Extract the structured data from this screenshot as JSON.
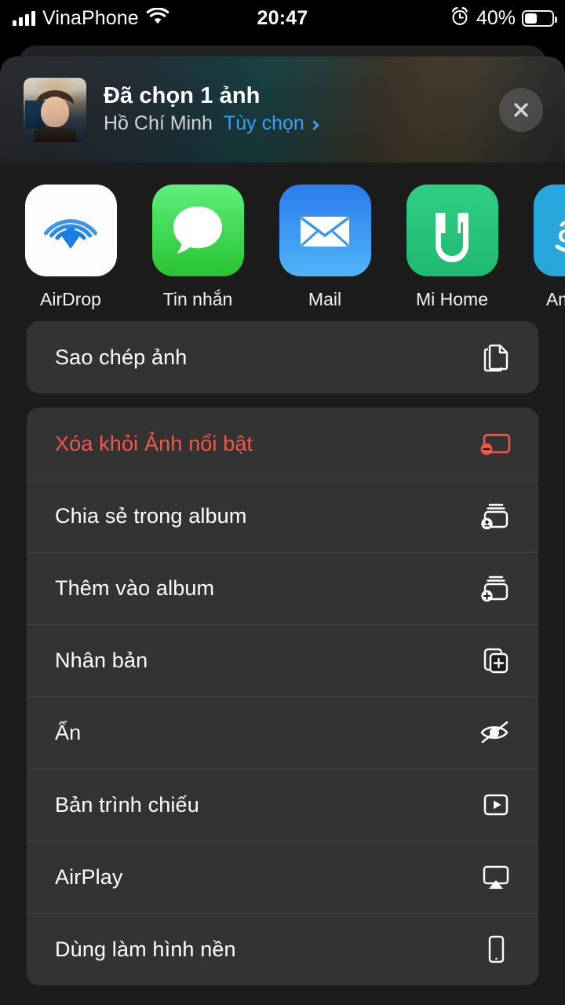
{
  "status_bar": {
    "carrier": "VinaPhone",
    "time": "20:47",
    "battery_percent": "40%",
    "battery_level": 40,
    "icons": [
      "signal-bars-icon",
      "wifi-icon",
      "alarm-clock-icon",
      "battery-icon"
    ]
  },
  "share_sheet": {
    "header": {
      "title": "Đã chọn 1 ảnh",
      "location": "Hồ Chí Minh",
      "options_label": "Tùy chọn",
      "options_color": "#3b9ef2",
      "close_label": "Đóng"
    },
    "apps": [
      {
        "label": "AirDrop",
        "icon": "airdrop-icon",
        "color": "#2f7ce0"
      },
      {
        "label": "Tin nhắn",
        "icon": "messages-icon",
        "color": "#28c231"
      },
      {
        "label": "Mail",
        "icon": "mail-icon",
        "color": "#2a7ceb"
      },
      {
        "label": "Mi Home",
        "icon": "mihome-icon",
        "color": "#1fb96f"
      },
      {
        "label": "Amazon",
        "icon": "amazon-icon",
        "color": "#28a7dd"
      }
    ],
    "action_groups": [
      {
        "rows": [
          {
            "label": "Sao chép ảnh",
            "icon": "copy-photo-icon",
            "destructive": false
          }
        ]
      },
      {
        "rows": [
          {
            "label": "Xóa khỏi Ảnh nổi bật",
            "icon": "remove-from-featured-icon",
            "destructive": true
          },
          {
            "label": "Chia sẻ trong album",
            "icon": "shared-album-icon",
            "destructive": false
          },
          {
            "label": "Thêm vào album",
            "icon": "add-to-album-icon",
            "destructive": false
          },
          {
            "label": "Nhân bản",
            "icon": "duplicate-icon",
            "destructive": false
          },
          {
            "label": "Ẩn",
            "icon": "hide-eye-slash-icon",
            "destructive": false
          },
          {
            "label": "Bản trình chiếu",
            "icon": "slideshow-play-icon",
            "destructive": false
          },
          {
            "label": "AirPlay",
            "icon": "airplay-icon",
            "destructive": false
          },
          {
            "label": "Dùng làm hình nền",
            "icon": "wallpaper-phone-icon",
            "destructive": false
          }
        ]
      }
    ]
  },
  "colors": {
    "destructive": "#f1574a",
    "accent": "#3b9ef2",
    "sheet_background": "#1c1c1c",
    "card_background": "#333333"
  }
}
